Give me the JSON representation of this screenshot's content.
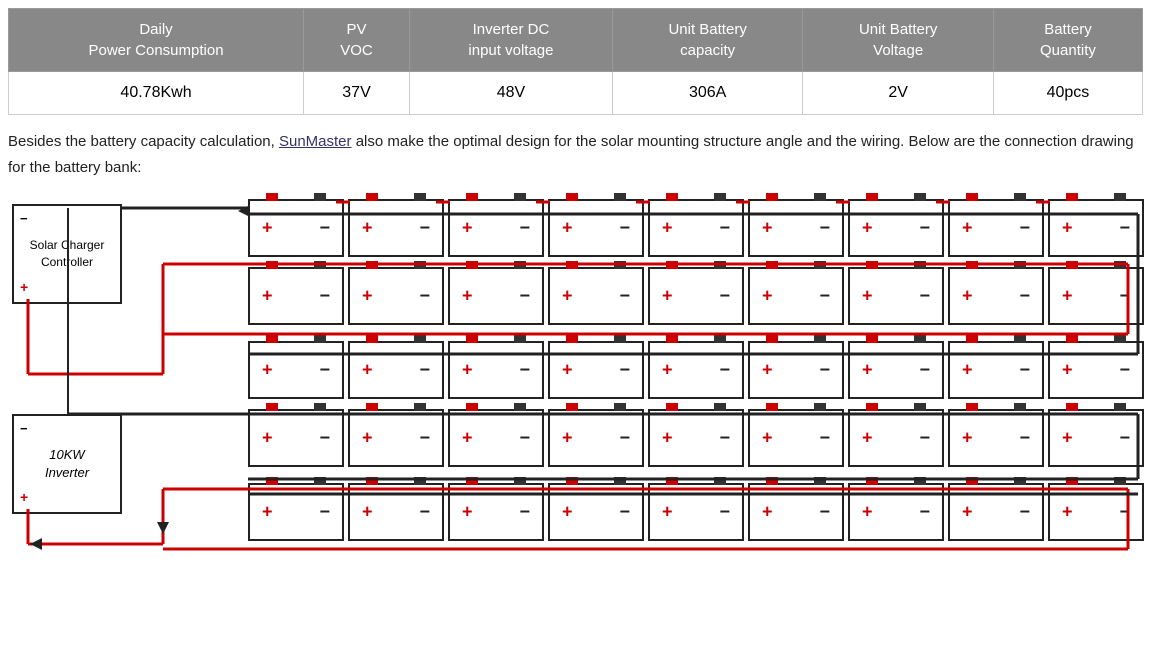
{
  "table": {
    "headers": [
      {
        "label": "Daily\nPower Consumption"
      },
      {
        "label": "PV\nVOC"
      },
      {
        "label": "Inverter DC\ninput voltage"
      },
      {
        "label": "Unit Battery\ncapacity"
      },
      {
        "label": "Unit Battery\nVoltage"
      },
      {
        "label": "Battery\nQuantity"
      }
    ],
    "row": {
      "daily_power": "40.78Kwh",
      "pv_voc": "37V",
      "inverter_dc": "48V",
      "unit_battery_capacity": "306A",
      "unit_battery_voltage": "2V",
      "battery_quantity": "40pcs"
    }
  },
  "description": {
    "text_before_link": "Besides the battery capacity calculation, ",
    "link_text": "SunMaster",
    "text_after_link": " also make the optimal design for the solar mounting structure angle and the wiring. Below are the connection drawing for the battery bank:"
  },
  "controller": {
    "label": "Solar Charger\nController",
    "minus_label": "−",
    "plus_label": "+"
  },
  "inverter": {
    "label": "10KW\nInverter",
    "minus_label": "−",
    "plus_label": "+"
  },
  "battery": {
    "plus_label": "+",
    "minus_label": "−",
    "rows": 5,
    "cols": 9
  }
}
